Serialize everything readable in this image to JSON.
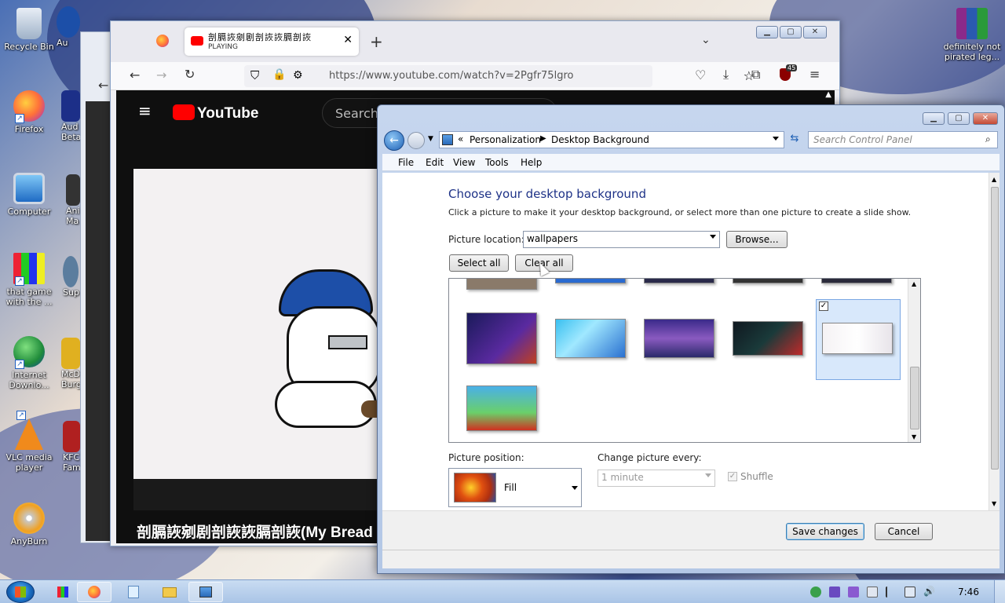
{
  "desktop": {
    "icons": [
      {
        "label": "Recycle Bin",
        "icon": "recycle-bin-icon"
      },
      {
        "label": "Firefox",
        "icon": "firefox-icon"
      },
      {
        "label": "Computer",
        "icon": "computer-icon"
      },
      {
        "label": "that game with the ...",
        "icon": "game-icon"
      },
      {
        "label": "Internet Downlo...",
        "icon": "internet-download-icon"
      },
      {
        "label": "VLC media player",
        "icon": "vlc-icon"
      },
      {
        "label": "AnyBurn",
        "icon": "anyburn-icon"
      }
    ],
    "partial_icons": [
      "Au",
      "Aud Beta",
      "Ani Ma",
      "Sup",
      "McD Burg",
      "KFC Fam"
    ],
    "right_icon": {
      "label": "definitely not pirated leg...",
      "icon": "winrar-icon"
    }
  },
  "firefox": {
    "tab_title": "剖膈詼剜剧剖詼詼膈剖詼",
    "tab_status": "PLAYING",
    "new_tab": "+",
    "url": "https://www.youtube.com/watch?v=2Pgfr75lgro",
    "extension_badge": "45"
  },
  "youtube": {
    "logo": "YouTube",
    "search_placeholder": "Search",
    "subtitle": "剖膈詼剜剧剖詼詼膈剖詼(My Bread was"
  },
  "control_panel": {
    "breadcrumb_prefix": "«",
    "breadcrumb": [
      "Personalization",
      "Desktop Background"
    ],
    "search_placeholder": "Search Control Panel",
    "menu": [
      "File",
      "Edit",
      "View",
      "Tools",
      "Help"
    ],
    "heading": "Choose your desktop background",
    "description": "Click a picture to make it your desktop background, or select more than one picture to create a slide show.",
    "picture_location_label": "Picture location:",
    "picture_location_value": "wallpapers",
    "browse_label": "Browse...",
    "select_all_label": "Select all",
    "clear_all_label": "Clear all",
    "picture_position_label": "Picture position:",
    "picture_position_value": "Fill",
    "change_every_label": "Change picture every:",
    "change_every_value": "1 minute",
    "shuffle_label": "Shuffle",
    "save_label": "Save changes",
    "cancel_label": "Cancel",
    "colors": {
      "heading": "#1e3287",
      "selection": "#d8e8fb"
    }
  },
  "taskbar": {
    "clock": "7:46"
  }
}
